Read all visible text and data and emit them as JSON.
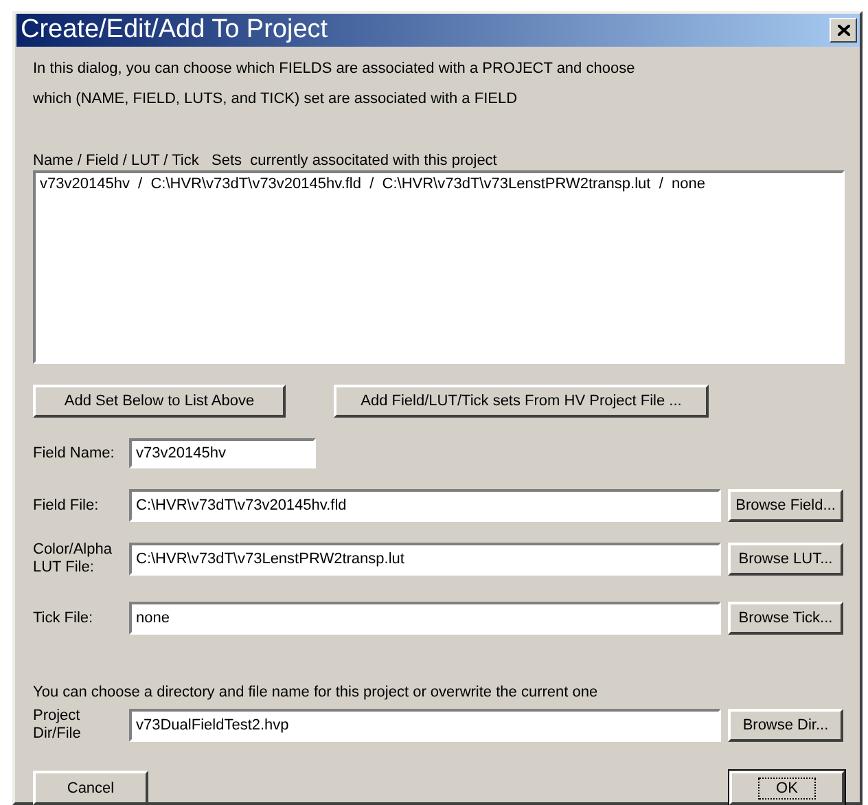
{
  "window": {
    "title": "Create/Edit/Add To Project"
  },
  "intro": [
    "In this dialog, you can choose which FIELDS are associated with a PROJECT and choose",
    "which (NAME, FIELD, LUTS, and TICK) set are associated with a FIELD"
  ],
  "sets_list": {
    "label": "Name / Field / LUT / Tick   Sets  currently associtated with this project",
    "items": [
      {
        "text": "v73v20145hv  /  C:\\HVR\\v73dT\\v73v20145hv.fld  /  C:\\HVR\\v73dT\\v73LenstPRW2transp.lut  /  none",
        "selected": false
      }
    ]
  },
  "set_buttons": [
    "Add Set Below to List Above",
    "Add Field/LUT/Tick sets From HV Project File ..."
  ],
  "fields": [
    {
      "kind": "short",
      "label": "Field Name:",
      "value": "v73v20145hv"
    },
    {
      "kind": "browse",
      "label": "Field File:",
      "value": "C:\\HVR\\v73dT\\v73v20145hv.fld",
      "button": "Browse Field..."
    },
    {
      "kind": "browse",
      "label": "Color/Alpha LUT File:",
      "value": "C:\\HVR\\v73dT\\v73LenstPRW2transp.lut",
      "button": "Browse LUT..."
    },
    {
      "kind": "browse",
      "label": "Tick File:",
      "value": "none",
      "button": "Browse Tick..."
    }
  ],
  "project_note": "You can choose a directory and file name for this project or overwrite the current one",
  "project": {
    "label": "Project Dir/File",
    "value": "v73DualFieldTest2.hvp",
    "button": "Browse Dir..."
  },
  "footer_buttons": [
    {
      "label": "Cancel",
      "focused": false
    },
    {
      "label": "OK",
      "focused": true
    }
  ]
}
